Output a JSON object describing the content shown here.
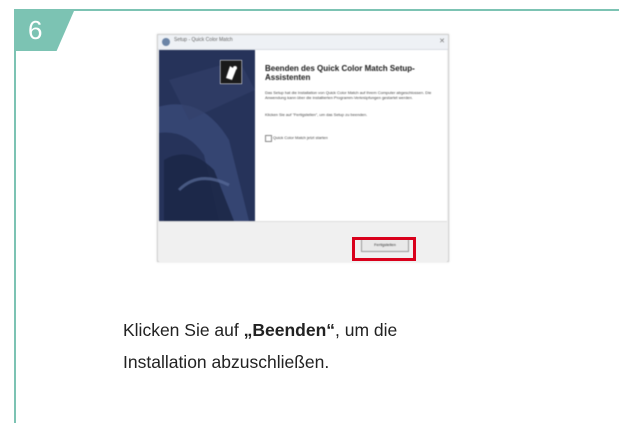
{
  "step": {
    "number": "6"
  },
  "colors": {
    "accent": "#7cc3b3",
    "highlight": "#d9001b",
    "sidebar": "#26335a"
  },
  "dialog": {
    "title": "Setup - Quick Color Match",
    "close_icon": "close-icon",
    "heading": "Beenden des Quick Color Match Setup-Assistenten",
    "paragraph1": "Das Setup hat die Installation von Quick Color Match auf Ihrem Computer abgeschlossen. Die Anwendung kann über die installierten Programm-Verknüpfungen gestartet werden.",
    "paragraph2": "Klicken Sie auf \"Fertigstellen\", um das Setup zu beenden.",
    "checkbox_label": "Quick Color Match jetzt starten",
    "finish_button": "Fertigstellen"
  },
  "instruction": {
    "prefix": "Klicken Sie auf ",
    "bold": "„Beenden“",
    "suffix": ", um die",
    "line2": "Installation abzuschließen."
  }
}
